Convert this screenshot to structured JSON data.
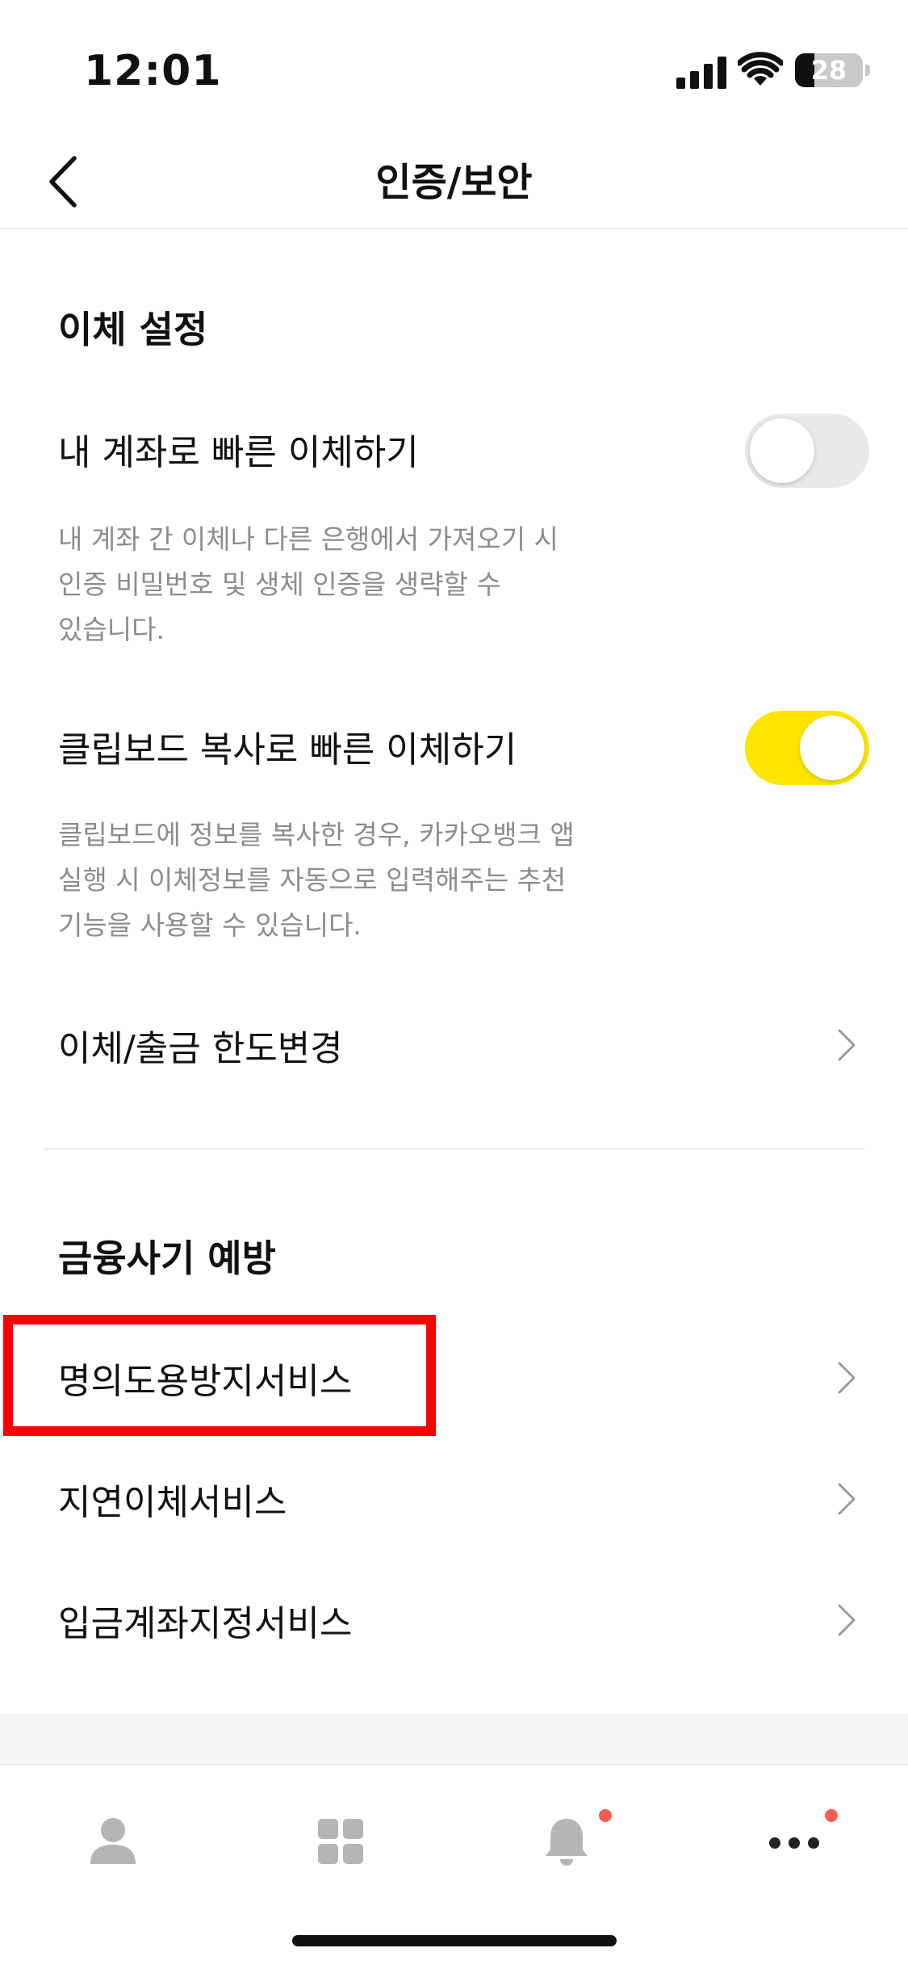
{
  "status_bar": {
    "time": "12:01",
    "battery_level": "28",
    "battery_fraction": 0.28
  },
  "nav": {
    "title": "인증/보안"
  },
  "transfer_settings": {
    "section_title": "이체 설정",
    "quick_transfer_own": {
      "label": "내 계좌로 빠른 이체하기",
      "enabled": false,
      "description_lines": [
        "내 계좌 간 이체나 다른 은행에서 가져오기 시",
        "인증 비밀번호 및 생체 인증을 생략할 수",
        "있습니다."
      ]
    },
    "quick_transfer_clipboard": {
      "label": "클립보드 복사로 빠른 이체하기",
      "enabled": true,
      "description_lines": [
        "클립보드에 정보를 복사한 경우, 카카오뱅크 앱",
        "실행 시 이체정보를 자동으로 입력해주는 추천",
        "기능을 사용할 수 있습니다."
      ]
    },
    "limit_change": {
      "label": "이체/출금 한도변경"
    }
  },
  "fraud_prevention": {
    "section_title": "금융사기 예방",
    "items": [
      {
        "label": "명의도용방지서비스"
      },
      {
        "label": "지연이체서비스"
      },
      {
        "label": "입금계좌지정서비스"
      }
    ]
  },
  "tab_bar": {
    "tabs": [
      {
        "icon": "person-icon",
        "badge": false
      },
      {
        "icon": "grid-icon",
        "badge": false
      },
      {
        "icon": "bell-icon",
        "badge": true
      },
      {
        "icon": "more-icon",
        "badge": true
      }
    ]
  },
  "colors": {
    "toggle_on": "#fee500",
    "toggle_off": "#e9e9e9",
    "highlight": "#ff0000",
    "badge": "#ff5a4f",
    "desc_text": "#8c8c8c"
  }
}
